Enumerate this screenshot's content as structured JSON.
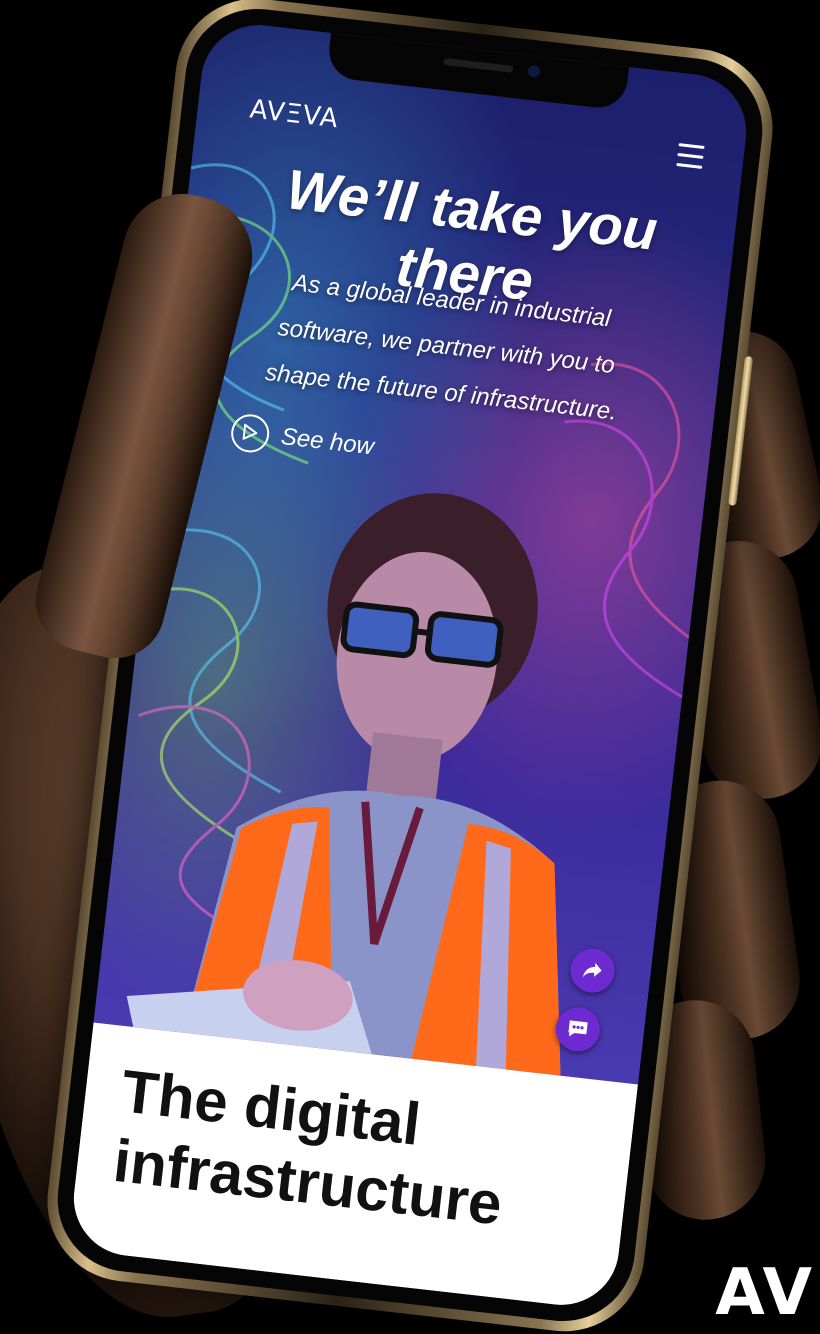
{
  "brand": {
    "logo_text": "AVΞVA",
    "corner_logo_text": "AV",
    "accent": "#6c2ad0"
  },
  "header": {
    "menu_icon": "hamburger-icon"
  },
  "hero": {
    "title": "We’ll take you there",
    "subtitle_lines": [
      "As a global leader in industrial",
      "software, we partner with you to",
      "shape the future of infrastructure."
    ],
    "cta_label": "See how",
    "cta_icon": "play-icon"
  },
  "floating_actions": {
    "share_icon": "share-icon",
    "chat_icon": "chat-icon"
  },
  "section": {
    "title_lines": [
      "The digital",
      "infrastructure"
    ]
  }
}
